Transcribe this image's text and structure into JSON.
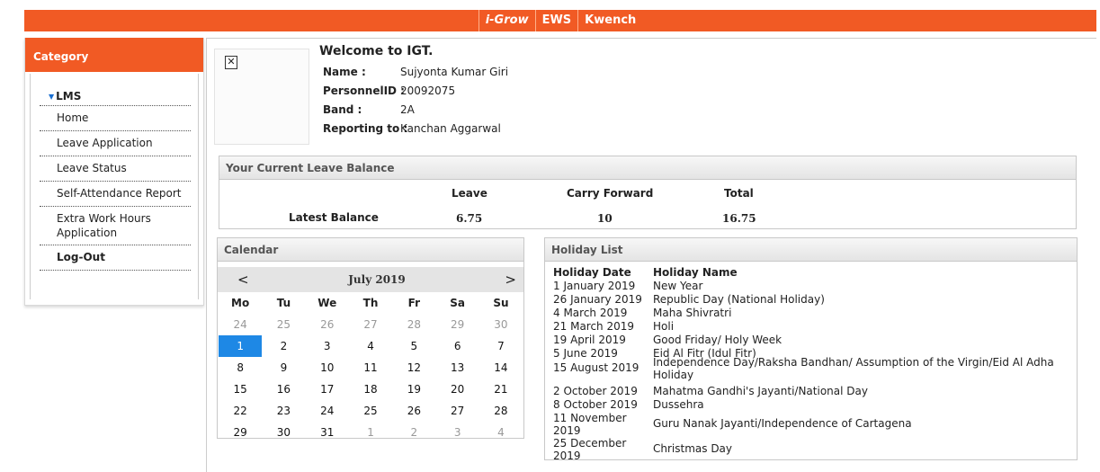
{
  "topnav": {
    "items": [
      "i-Grow",
      "EWS",
      "Kwench"
    ]
  },
  "sidebar": {
    "header": "Category",
    "section": "LMS",
    "items": [
      {
        "label": "Home"
      },
      {
        "label": "Leave Application"
      },
      {
        "label": "Leave Status"
      },
      {
        "label": "Self-Attendance Report"
      },
      {
        "label": "Extra Work Hours Application"
      },
      {
        "label": "Log-Out"
      }
    ]
  },
  "profile": {
    "welcome": "Welcome to IGT.",
    "fields": [
      {
        "key": "Name :",
        "value": "Sujyonta Kumar Giri"
      },
      {
        "key": "PersonnelID :",
        "value": "20092075"
      },
      {
        "key": "Band :",
        "value": "2A"
      },
      {
        "key": "Reporting to :",
        "value": "Kanchan Aggarwal"
      }
    ]
  },
  "leave_balance": {
    "title": "Your Current Leave Balance",
    "headers": [
      "Leave",
      "Carry Forward",
      "Total"
    ],
    "row_label": "Latest Balance",
    "values": [
      "6.75",
      "10",
      "16.75"
    ]
  },
  "calendar": {
    "title": "Calendar",
    "prev": "<",
    "next": ">",
    "month": "July 2019",
    "day_headers": [
      "Mo",
      "Tu",
      "We",
      "Th",
      "Fr",
      "Sa",
      "Su"
    ],
    "weeks": [
      [
        "24",
        "25",
        "26",
        "27",
        "28",
        "29",
        "30"
      ],
      [
        "1",
        "2",
        "3",
        "4",
        "5",
        "6",
        "7"
      ],
      [
        "8",
        "9",
        "10",
        "11",
        "12",
        "13",
        "14"
      ],
      [
        "15",
        "16",
        "17",
        "18",
        "19",
        "20",
        "21"
      ],
      [
        "22",
        "23",
        "24",
        "25",
        "26",
        "27",
        "28"
      ],
      [
        "29",
        "30",
        "31",
        "1",
        "2",
        "3",
        "4"
      ]
    ],
    "selected": "1"
  },
  "holidays": {
    "title": "Holiday List",
    "headers": [
      "Holiday Date",
      "Holiday Name"
    ],
    "rows": [
      {
        "date": "1 January 2019",
        "name": "New Year"
      },
      {
        "date": "26 January 2019",
        "name": "Republic Day (National Holiday)"
      },
      {
        "date": "4 March 2019",
        "name": "Maha Shivratri"
      },
      {
        "date": "21 March 2019",
        "name": "Holi"
      },
      {
        "date": "19 April 2019",
        "name": "Good Friday/ Holy Week"
      },
      {
        "date": "5 June 2019",
        "name": "Eid Al Fitr (Idul Fitr)"
      },
      {
        "date": "15 August 2019",
        "name": "Independence Day/Raksha Bandhan/ Assumption of the Virgin/Eid Al Adha Holiday"
      },
      {
        "date": "2 October 2019",
        "name": "Mahatma Gandhi's Jayanti/National Day"
      },
      {
        "date": "8 October 2019",
        "name": "Dussehra"
      },
      {
        "date": "11 November 2019",
        "name": "Guru Nanak Jayanti/Independence of Cartagena"
      },
      {
        "date": "25 December 2019",
        "name": "Christmas Day"
      }
    ]
  },
  "colors": {
    "accent": "#f15a24",
    "selected_day": "#1e88e5"
  }
}
